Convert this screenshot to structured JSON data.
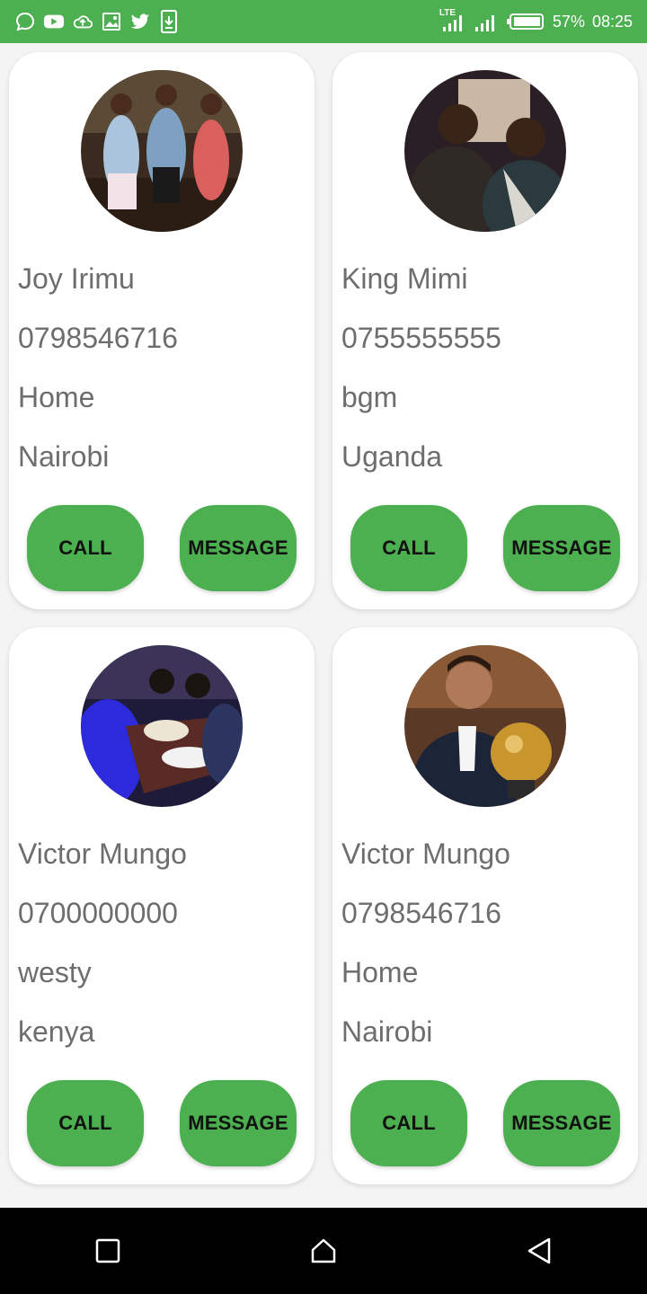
{
  "status_bar": {
    "network": "LTE",
    "battery": "57%",
    "time": "08:25",
    "left_icons": [
      "chat-icon",
      "youtube-icon",
      "cloud-upload-icon",
      "image-icon",
      "twitter-icon",
      "download-icon"
    ]
  },
  "contacts": [
    {
      "name": "Joy Irimu",
      "phone": "0798546716",
      "label": "Home",
      "location": "Nairobi",
      "call_label": "CALL",
      "message_label": "MESSAGE"
    },
    {
      "name": "King Mimi",
      "phone": "0755555555",
      "label": "bgm",
      "location": "Uganda",
      "call_label": "CALL",
      "message_label": "MESSAGE"
    },
    {
      "name": "Victor Mungo",
      "phone": "0700000000",
      "label": "westy",
      "location": "kenya",
      "call_label": "CALL",
      "message_label": "MESSAGE"
    },
    {
      "name": "Victor Mungo",
      "phone": "0798546716",
      "label": "Home",
      "location": "Nairobi",
      "call_label": "CALL",
      "message_label": "MESSAGE"
    }
  ],
  "colors": {
    "accent": "#4caf50",
    "text": "#6d6d6d",
    "button_text": "#111111",
    "nav_bar": "#000000"
  },
  "nav_bar": {
    "buttons": [
      "recents-icon",
      "home-icon",
      "back-icon"
    ]
  }
}
